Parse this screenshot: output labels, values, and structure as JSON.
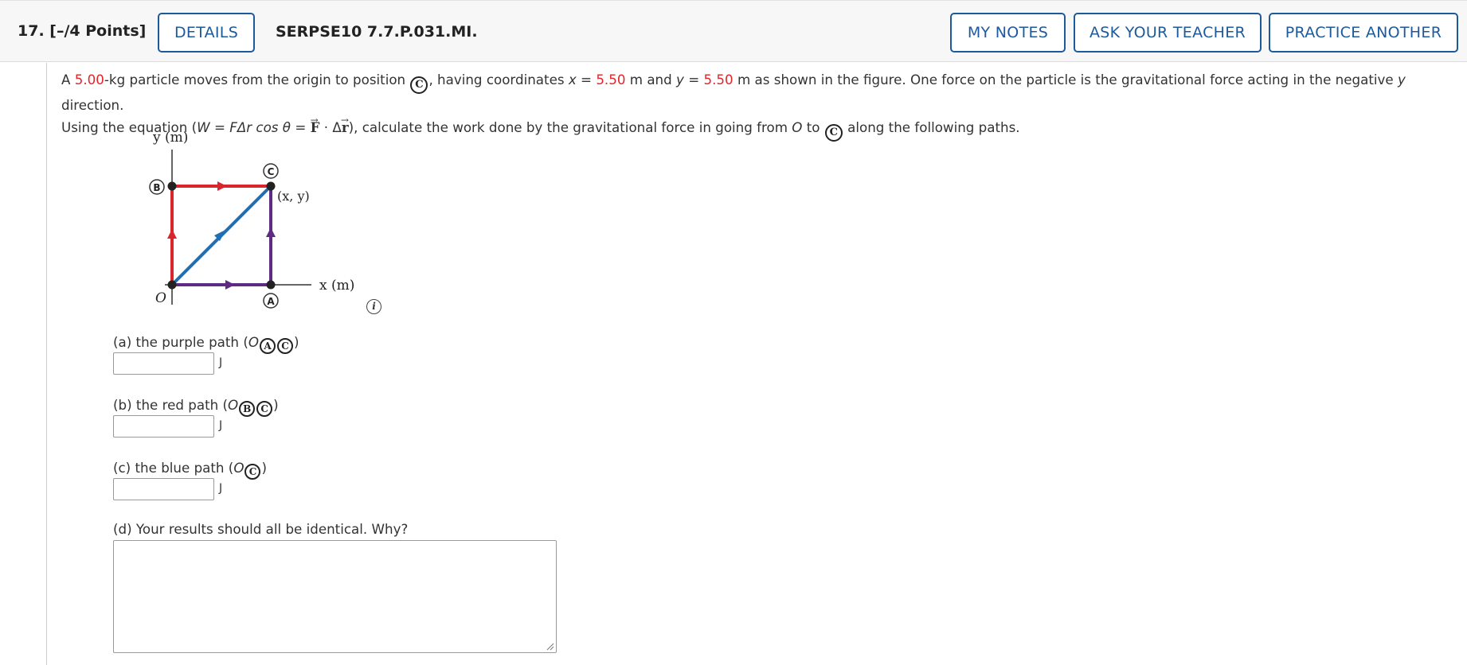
{
  "header": {
    "question_number": "17.",
    "points": "[–/4 Points]",
    "details_button": "DETAILS",
    "question_id": "SERPSE10 7.7.P.031.MI.",
    "my_notes_button": "MY NOTES",
    "ask_teacher_button": "ASK YOUR TEACHER",
    "practice_another_button": "PRACTICE ANOTHER"
  },
  "problem": {
    "t1": "A ",
    "mass": "5.00",
    "t2": "-kg particle moves from the origin to position ",
    "t3": ", having coordinates ",
    "x_eq": "x = ",
    "x_val": "5.50",
    "t4": " m and ",
    "y_eq": "y = ",
    "y_val": "5.50",
    "t5": " m as shown in the figure. One force on the particle is the gravitational force acting in the negative ",
    "y_dir": "y",
    "t6": " direction.",
    "t7": "Using the equation (",
    "eq_work": "W = FΔr cos θ = ",
    "eq_F": "F",
    "eq_dot": " · Δ",
    "eq_r": "r",
    "t8": "), calculate the work done by the gravitational force in going from ",
    "O": "O",
    "t9": " to ",
    "t10": " along the following paths.",
    "point_c": "C"
  },
  "figure": {
    "y_axis_label": "y (m)",
    "x_axis_label": "x (m)",
    "origin_label": "O",
    "coord_label": "(x, y)",
    "point_a": "A",
    "point_b": "B",
    "point_c": "C",
    "colors": {
      "red": "#d9252b",
      "purple": "#5d2a84",
      "blue": "#1f6fb5"
    }
  },
  "parts": {
    "a_label": "(a) the purple path (",
    "b_label": "(b) the red path (",
    "c_label": "(c) the blue path (",
    "O": "O",
    "close": ")",
    "A": "A",
    "B": "B",
    "C": "C",
    "unit": "J",
    "d_label": "(d) Your results should all be identical. Why?",
    "a_value": "",
    "b_value": "",
    "c_value": "",
    "d_value": ""
  }
}
